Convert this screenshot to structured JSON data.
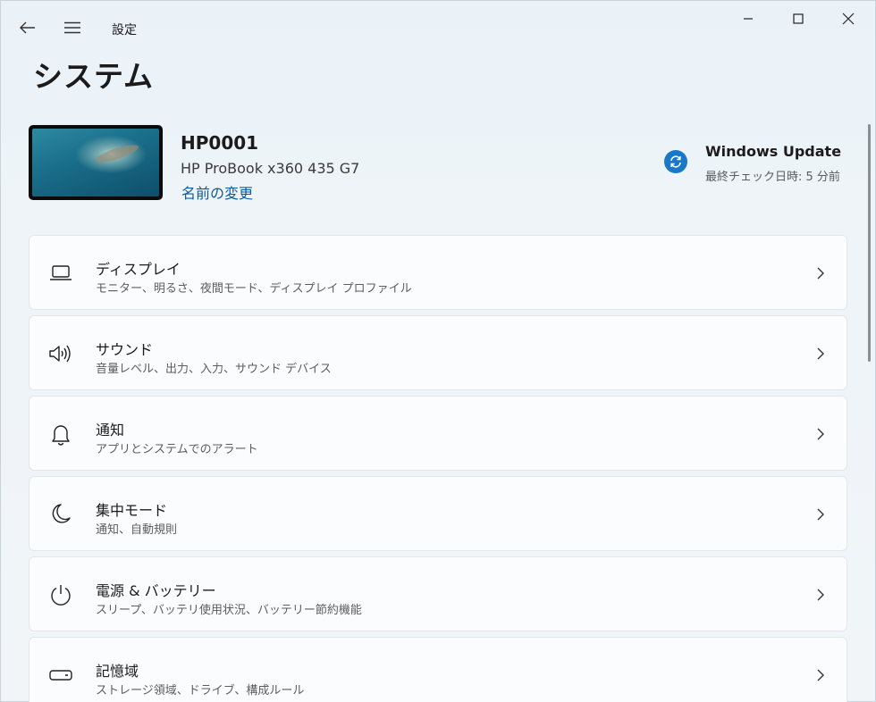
{
  "app_title": "設定",
  "page_title": "システム",
  "device": {
    "name": "HP0001",
    "model": "HP ProBook x360 435 G7",
    "rename_link": "名前の変更"
  },
  "windows_update": {
    "title": "Windows Update",
    "status": "最終チェック日時: 5 分前"
  },
  "settings": [
    {
      "icon": "laptop-icon",
      "title": "ディスプレイ",
      "desc": "モニター、明るさ、夜間モード、ディスプレイ プロファイル"
    },
    {
      "icon": "speaker-icon",
      "title": "サウンド",
      "desc": "音量レベル、出力、入力、サウンド デバイス"
    },
    {
      "icon": "bell-icon",
      "title": "通知",
      "desc": "アプリとシステムでのアラート"
    },
    {
      "icon": "moon-icon",
      "title": "集中モード",
      "desc": "通知、自動規則"
    },
    {
      "icon": "power-icon",
      "title": "電源 & バッテリー",
      "desc": "スリープ、バッテリ使用状況、バッテリー節約機能"
    },
    {
      "icon": "storage-icon",
      "title": "記憶域",
      "desc": "ストレージ領域、ドライブ、構成ルール"
    }
  ],
  "colors": {
    "accent": "#1a78c9",
    "link": "#0f5a9c"
  }
}
